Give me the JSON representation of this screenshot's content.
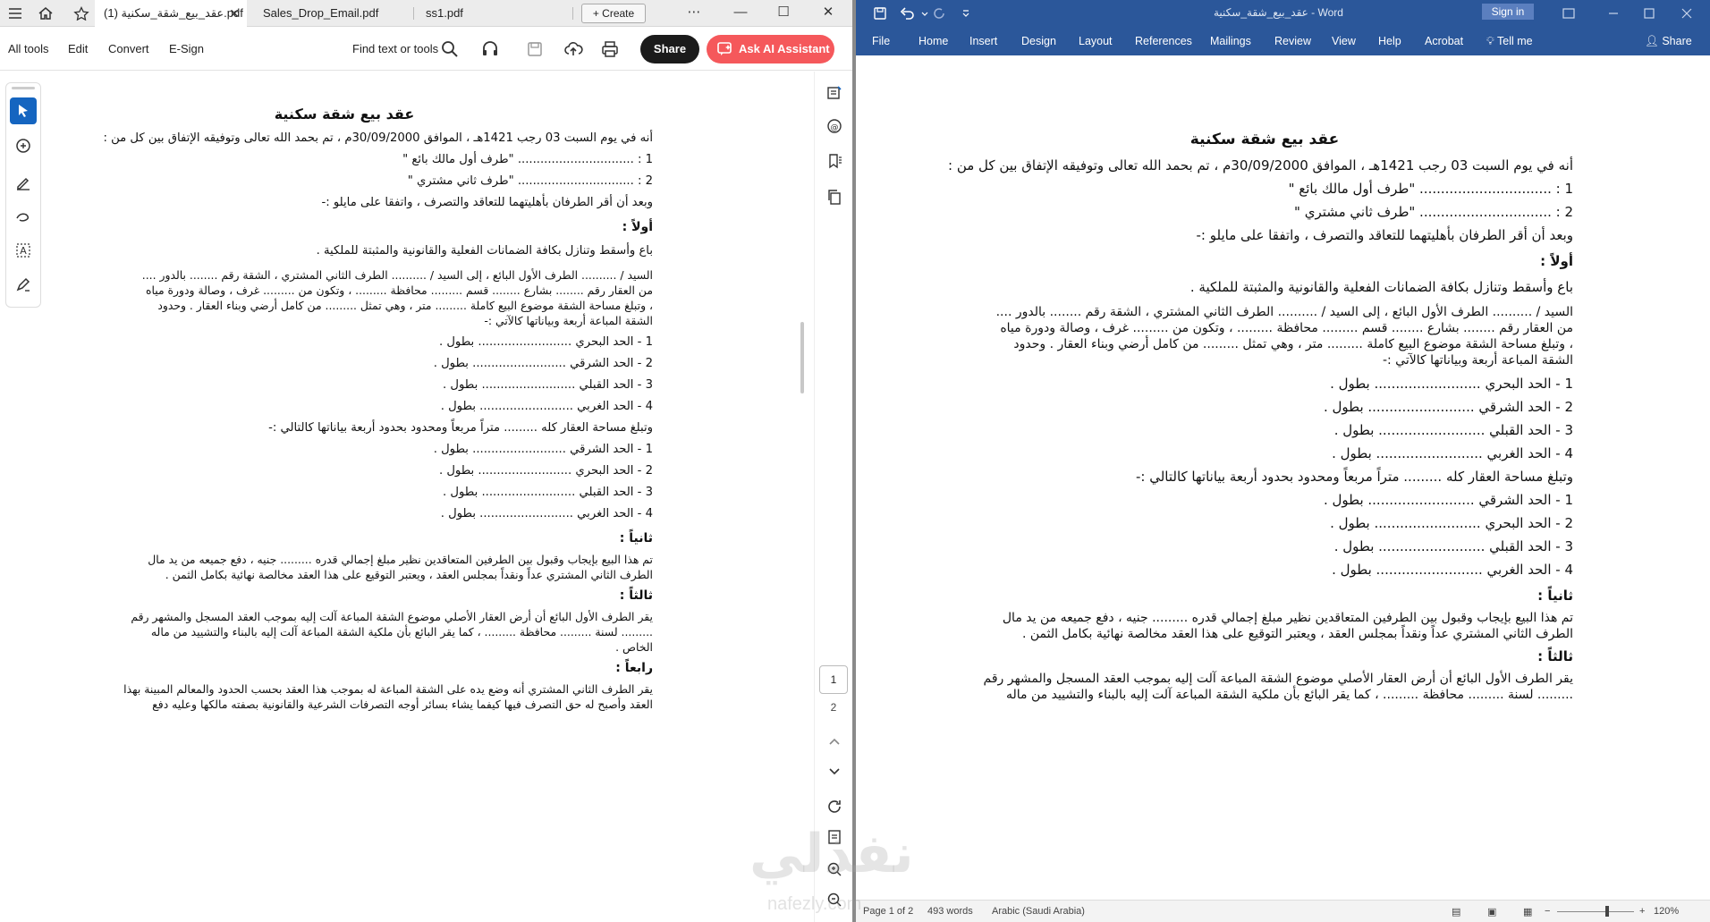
{
  "pdf_viewer": {
    "tabs": [
      {
        "label": "عقد_بيع_شقة_سكنية (1).pdf",
        "active": true
      },
      {
        "label": "Sales_Drop_Email.pdf",
        "active": false
      },
      {
        "label": "ss1.pdf",
        "active": false
      }
    ],
    "create_label": "Create",
    "menu": {
      "all_tools": "All tools",
      "edit": "Edit",
      "convert": "Convert",
      "esign": "E-Sign"
    },
    "find_label": "Find text or tools",
    "share_label": "Share",
    "ai_label": "Ask AI Assistant",
    "page_current": "1",
    "page_total": "2",
    "brand_color": "#f5585b"
  },
  "word": {
    "title": "عقد_بيع_شقة_سكنية - Word",
    "signin_label": "Sign in",
    "tabs": [
      "File",
      "Home",
      "Insert",
      "Design",
      "Layout",
      "References",
      "Mailings",
      "Review",
      "View",
      "Help",
      "Acrobat",
      "Tell me",
      "Share"
    ],
    "status": {
      "page": "Page 1 of 2",
      "words": "493 words",
      "language": "Arabic (Saudi Arabia)",
      "zoom": "120%"
    },
    "ribbon_color": "#2b579a"
  },
  "document": {
    "title": "عقد بيع شقة سكنية",
    "intro": "أنه في يوم السبت 03 رجب 1421هـ ، الموافق 30/09/2000م ، تم بحمد الله تعالى وتوفيقه الإتفاق بين كل من :",
    "party1": "1 : ............................... \"طرف أول مالك بائع \"",
    "party2": "2 : ............................... \"طرف ثاني مشتري \"",
    "agreement": "وبعد أن أقر الطرفان بأهليتهما للتعاقد والتصرف ، واتفقا على مايلو :-",
    "first_heading": "أولاً :",
    "first_line": "باع وأسقط وتنازل بكافة الضمانات الفعلية والقانونية والمثبتة للملكية .",
    "first_para": [
      "السيد / .......... الطرف الأول البائع ، إلى السيد / .......... الطرف الثاني المشتري ، الشقة رقم ........ بالدور ....",
      "من العقار رقم ........ بشارع ........ قسم ......... محافظة ......... ، وتكون من ......... غرف ، وصالة ودورة مياه",
      "، وتبلغ مساحة الشقة موضوع البيع كاملة ......... متر ، وهي تمثل ......... من كامل أرضي وبناء العقار . وحدود",
      "الشقة المباعة أربعة وبياناتها كالآتي :-"
    ],
    "borders_a": [
      "1 - الحد البحري ......................... بطول .",
      "2 - الحد الشرقي ......................... بطول .",
      "3 - الحد القبلي ......................... بطول .",
      "4 - الحد الغربي ......................... بطول ."
    ],
    "area_line": "وتبلغ مساحة العقار كله ......... متراً مربعاً ومحدود بحدود أربعة بياناتها كالتالي :-",
    "borders_b": [
      "1 - الحد الشرقي ......................... بطول .",
      "2 - الحد البحري ......................... بطول .",
      "3 - الحد القبلي ......................... بطول .",
      "4 - الحد الغربي ......................... بطول ."
    ],
    "second_heading": "ثانياً :",
    "second_para": [
      "تم هذا البيع بإيجاب وقبول بين الطرفين المتعاقدين نظير مبلغ إجمالي قدره ......... جنيه ، دفع جميعه من يد مال",
      "الطرف الثاني المشتري عداً ونقداً بمجلس العقد ، ويعتبر التوقيع على هذا العقد مخالصة نهائية بكامل الثمن ."
    ],
    "third_heading": "ثالثاً :",
    "third_para": [
      "يقر الطرف الأول البائع أن أرض العقار الأصلي موضوع الشقة المباعة آلت إليه بموجب العقد المسجل والمشهر رقم",
      "......... لسنة ......... محافظة ......... ، كما يقر البائع بأن ملكية الشقة المباعة آلت إليه بالبناء والتشييد من ماله",
      "الخاص ."
    ],
    "fourth_heading": "رابعاً :",
    "fourth_para": [
      "يقر الطرف الثاني المشتري أنه وضع يده على الشقة المباعة له بموجب هذا العقد بحسب الحدود والمعالم المبينة بهذا",
      "العقد وأصبح له حق التصرف فيها كيفما يشاء بسائر أوجه التصرفات الشرعية والقانونية بصفته مالكها وعليه دفع"
    ]
  },
  "watermark": {
    "text": "نفذلي",
    "sub": "nafezly.com"
  }
}
